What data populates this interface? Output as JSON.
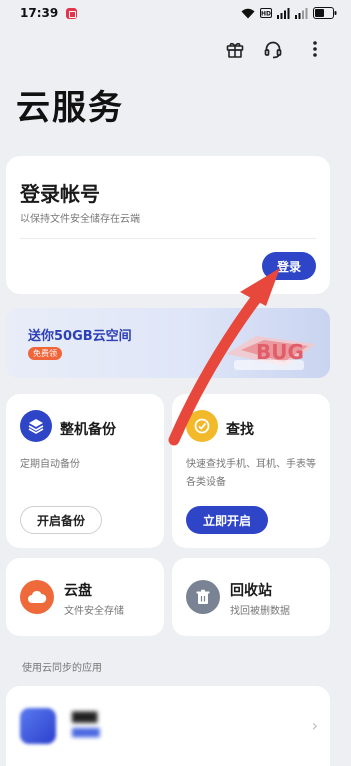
{
  "status_bar": {
    "time": "17:39",
    "battery": "46"
  },
  "page": {
    "title": "云服务"
  },
  "toolbar": {
    "gift_icon": "gift-icon",
    "support_icon": "headset-icon",
    "more_icon": "more-vertical-icon"
  },
  "login_card": {
    "title": "登录帐号",
    "subtitle": "以保持文件安全储存在云端",
    "button_label": "登录"
  },
  "banner": {
    "title": "送你50GB云空间",
    "badge": "免费领"
  },
  "backup_card": {
    "title": "整机备份",
    "description": "定期自动备份",
    "button_label": "开启备份"
  },
  "find_card": {
    "title": "查找",
    "description": "快速查找手机、耳机、手表等各类设备",
    "button_label": "立即开启"
  },
  "disk_card": {
    "title": "云盘",
    "description": "文件安全存储"
  },
  "bin_card": {
    "title": "回收站",
    "description": "找回被删数据"
  },
  "sync_section": {
    "label": "使用云同步的应用"
  },
  "colors": {
    "accent": "#2f45c8",
    "arrow": "#e8483c",
    "banner_text": "#2d3fb6",
    "badge": "#f0653a"
  }
}
